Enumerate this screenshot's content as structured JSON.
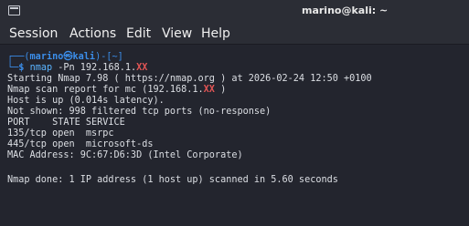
{
  "window": {
    "title": "marino@kali: ~"
  },
  "menu": {
    "items": [
      "Session",
      "Actions",
      "Edit",
      "View",
      "Help"
    ]
  },
  "prompt": {
    "open_bracket": "┌──(",
    "user_host": "marino㉿kali",
    "path": ")-[~]",
    "second_line_prefix": "└─",
    "dollar": "$ ",
    "command": "nmap",
    "args": " -Pn 192.168.1.",
    "redacted": "XX"
  },
  "output": {
    "line1": "Starting Nmap 7.98 ( https://nmap.org ) at 2026-02-24 12:50 +0100",
    "line2_a": "Nmap scan report for mc (192.168.1.",
    "line2_red": "XX",
    "line2_b": " )",
    "line3": "Host is up (0.014s latency).",
    "line4": "Not shown: 998 filtered tcp ports (no-response)",
    "line5": "PORT    STATE SERVICE",
    "line6": "135/tcp open  msrpc",
    "line7": "445/tcp open  microsoft-ds",
    "line8": "MAC Address: 9C:67:D6:3D (Intel Corporate)",
    "line9": "Nmap done: 1 IP address (1 host up) scanned in 5.60 seconds"
  }
}
